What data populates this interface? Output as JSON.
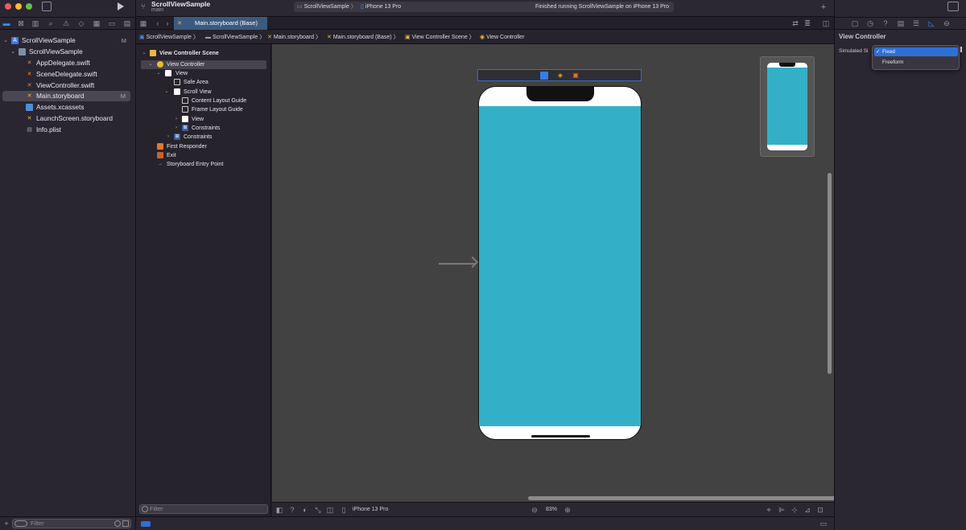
{
  "project": {
    "name": "ScrollViewSample",
    "branch": "main"
  },
  "run_destination": {
    "scheme": "ScrollViewSample",
    "device": "iPhone 13 Pro"
  },
  "activity": {
    "status": "Finished running ScrollViewSample on iPhone 13 Pro"
  },
  "tab": {
    "label": "Main.storyboard (Base)"
  },
  "breadcrumbs": [
    "ScrollViewSample",
    "ScrollViewSample",
    "Main.storyboard",
    "Main.storyboard (Base)",
    "View Controller Scene",
    "View Controller"
  ],
  "navigator": {
    "items": [
      {
        "label": "ScrollViewSample",
        "badge": "M",
        "icon": "project-icon"
      },
      {
        "label": "ScrollViewSample",
        "badge": "",
        "icon": "folder-icon"
      },
      {
        "label": "AppDelegate.swift",
        "badge": "",
        "icon": "swift-icon"
      },
      {
        "label": "SceneDelegate.swift",
        "badge": "",
        "icon": "swift-icon"
      },
      {
        "label": "ViewController.swift",
        "badge": "",
        "icon": "swift-icon"
      },
      {
        "label": "Main.storyboard",
        "badge": "M",
        "icon": "storyboard-icon"
      },
      {
        "label": "Assets.xcassets",
        "badge": "",
        "icon": "assets-icon"
      },
      {
        "label": "LaunchScreen.storyboard",
        "badge": "",
        "icon": "storyboard-icon"
      },
      {
        "label": "Info.plist",
        "badge": "",
        "icon": "plist-icon"
      }
    ],
    "filter_placeholder": "Filter"
  },
  "outline": {
    "items": [
      {
        "label": "View Controller Scene"
      },
      {
        "label": "View Controller"
      },
      {
        "label": "View"
      },
      {
        "label": "Safe Area"
      },
      {
        "label": "Scroll View"
      },
      {
        "label": "Content Layout Guide"
      },
      {
        "label": "Frame Layout Guide"
      },
      {
        "label": "View"
      },
      {
        "label": "Constraints"
      },
      {
        "label": "Constraints"
      },
      {
        "label": "First Responder"
      },
      {
        "label": "Exit"
      },
      {
        "label": "Storyboard Entry Point"
      }
    ],
    "filter_placeholder": "Filter"
  },
  "canvas": {
    "device_label": "iPhone 13 Pro",
    "zoom": "83%",
    "view_color": "#33b0c8"
  },
  "inspector": {
    "title": "View Controller",
    "simulated_label": "Simulated Si",
    "options": [
      "Fixed",
      "Freeform"
    ],
    "selected": "Fixed"
  },
  "colors": {
    "accent": "#2f6fd6",
    "swift": "#f0883e",
    "storyboard": "#e9b93d"
  }
}
